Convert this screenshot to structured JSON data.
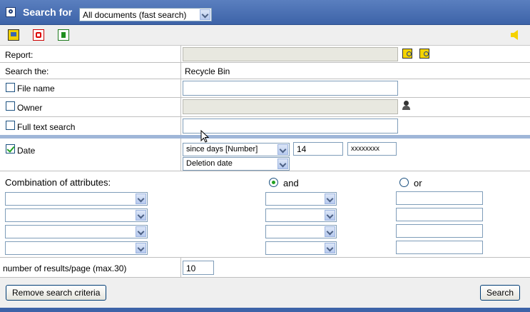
{
  "header": {
    "title": "Search for",
    "scope_value": "All documents (fast search)"
  },
  "toolbar": {
    "icons": [
      "save-icon",
      "pdf-icon",
      "excel-icon",
      "back-arrow-icon"
    ]
  },
  "form": {
    "report_label": "Report:",
    "search_the_label": "Search the:",
    "search_the_value": "Recycle Bin",
    "file_name_label": "File name",
    "owner_label": "Owner",
    "fulltext_label": "Full text search",
    "date_label": "Date",
    "date_mode_value": "since days [Number]",
    "date_days_value": "14",
    "date_extra_value": "xxxxxxxx",
    "date_type_value": "Deletion date",
    "combination_label": "Combination of attributes:",
    "and_label": "and",
    "or_label": "or",
    "results_label": "number of results/page (max.30)",
    "results_value": "10"
  },
  "footer": {
    "remove_label": "Remove search criteria",
    "search_label": "Search"
  }
}
